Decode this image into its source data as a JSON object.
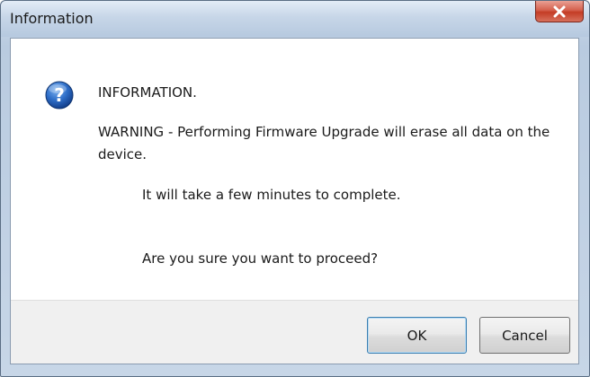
{
  "window": {
    "title": "Information",
    "close_icon": "close-icon",
    "colors": {
      "close_button": "#c8432d",
      "titlebar": "#c7d6e8",
      "default_button_border": "#3c7fb1"
    }
  },
  "message": {
    "icon": "question-icon",
    "heading": "INFORMATION.",
    "warning": "WARNING - Performing Firmware Upgrade will erase all data on the device.",
    "duration": "It will take a few minutes to complete.",
    "question": "Are you sure you want to proceed?"
  },
  "buttons": {
    "ok_label": "OK",
    "cancel_label": "Cancel"
  }
}
